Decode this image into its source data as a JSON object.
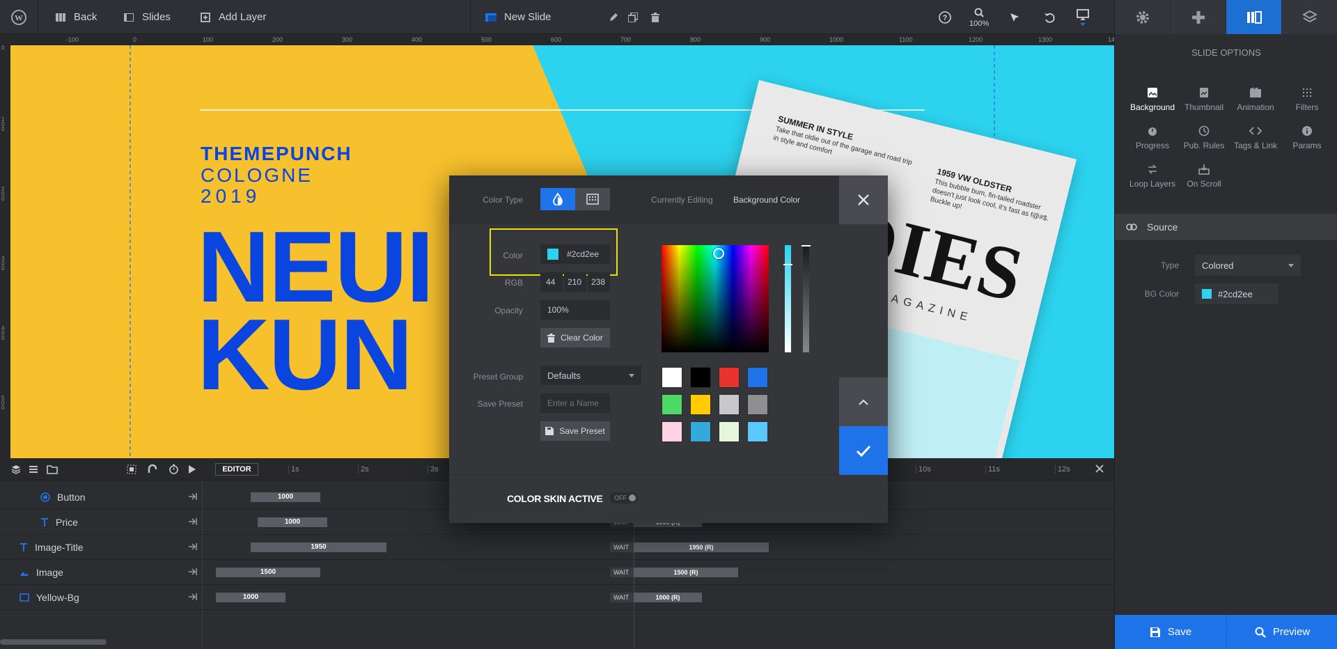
{
  "toolbar": {
    "back": "Back",
    "slides": "Slides",
    "add_layer": "Add Layer",
    "slide_title": "New Slide",
    "zoom": "100%"
  },
  "ruler": {
    "ticks": [
      "-100",
      "0",
      "100",
      "200",
      "300",
      "400",
      "500",
      "600",
      "700",
      "800",
      "900",
      "1000",
      "1100",
      "1200",
      "1300",
      "14"
    ]
  },
  "slide": {
    "brand": "THEMEPUNCH",
    "city": "COLOGNE",
    "year": "2019",
    "headline_1": "NEUI",
    "headline_2": "KUN",
    "mag_story1_title": "SUMMER IN STYLE",
    "mag_story1_text": "Take that oldie out of the garage and road trip in style and comfort",
    "mag_story2_title": "1959 VW OLDSTER",
    "mag_story2_text": "This bubble bum, fin-tailed roadster doesn't just look cool, it's fast as f@#$. Buckle up!",
    "mag_big": "DIES",
    "mag_sub": "MAGAZINE",
    "yellow": "#f7c02d",
    "cyan": "#2cd2ee",
    "blue": "#0b45e0"
  },
  "right_panel": {
    "title": "SLIDE OPTIONS",
    "options": [
      "Background",
      "Thumbnail",
      "Animation",
      "Filters",
      "Progress",
      "Pub. Rules",
      "Tags & Link",
      "Params",
      "Loop Layers",
      "On Scroll"
    ],
    "source_label": "Source",
    "type_label": "Type",
    "type_value": "Colored",
    "bg_color_label": "BG Color",
    "bg_color_value": "#2cd2ee",
    "save": "Save",
    "preview": "Preview"
  },
  "timeline": {
    "editor_label": "EDITOR",
    "seconds": [
      "1s",
      "2s",
      "3s",
      "10s",
      "11s",
      "12s"
    ],
    "wait_label": "WAIT",
    "rows": [
      {
        "name": "Button",
        "bar": "1000",
        "wait_value": ""
      },
      {
        "name": "Price",
        "bar": "1000",
        "wait_value": "1000 (R)"
      },
      {
        "name": "Image-Title",
        "bar": "1950",
        "wait_value": "1950 (R)"
      },
      {
        "name": "Image",
        "bar": "1500",
        "wait_value": "1500 (R)"
      },
      {
        "name": "Yellow-Bg",
        "bar": "1000",
        "wait_value": "1000 (R)"
      }
    ]
  },
  "color_dialog": {
    "color_type_label": "Color Type",
    "currently_editing_label": "Currently Editing",
    "currently_editing_value": "Background Color",
    "color_label": "Color",
    "color_value": "#2cd2ee",
    "rgb_label": "RGB",
    "r": "44",
    "g": "210",
    "b": "238",
    "opacity_label": "Opacity",
    "opacity_value": "100%",
    "clear_color": "Clear Color",
    "preset_group_label": "Preset Group",
    "preset_group_value": "Defaults",
    "save_preset_label": "Save Preset",
    "save_preset_placeholder": "Enter a Name",
    "save_preset_button": "Save Preset",
    "skin_label": "COLOR SKIN ACTIVE",
    "skin_toggle": "OFF",
    "swatches": [
      "#ffffff",
      "#000000",
      "#e8322d",
      "#1e73e8",
      "#4cd964",
      "#ffcc00",
      "#c7c7cc",
      "#8e8e93",
      "#ffd4e0",
      "#34aadc",
      "#e4f7dc",
      "#5ac8fa"
    ]
  }
}
